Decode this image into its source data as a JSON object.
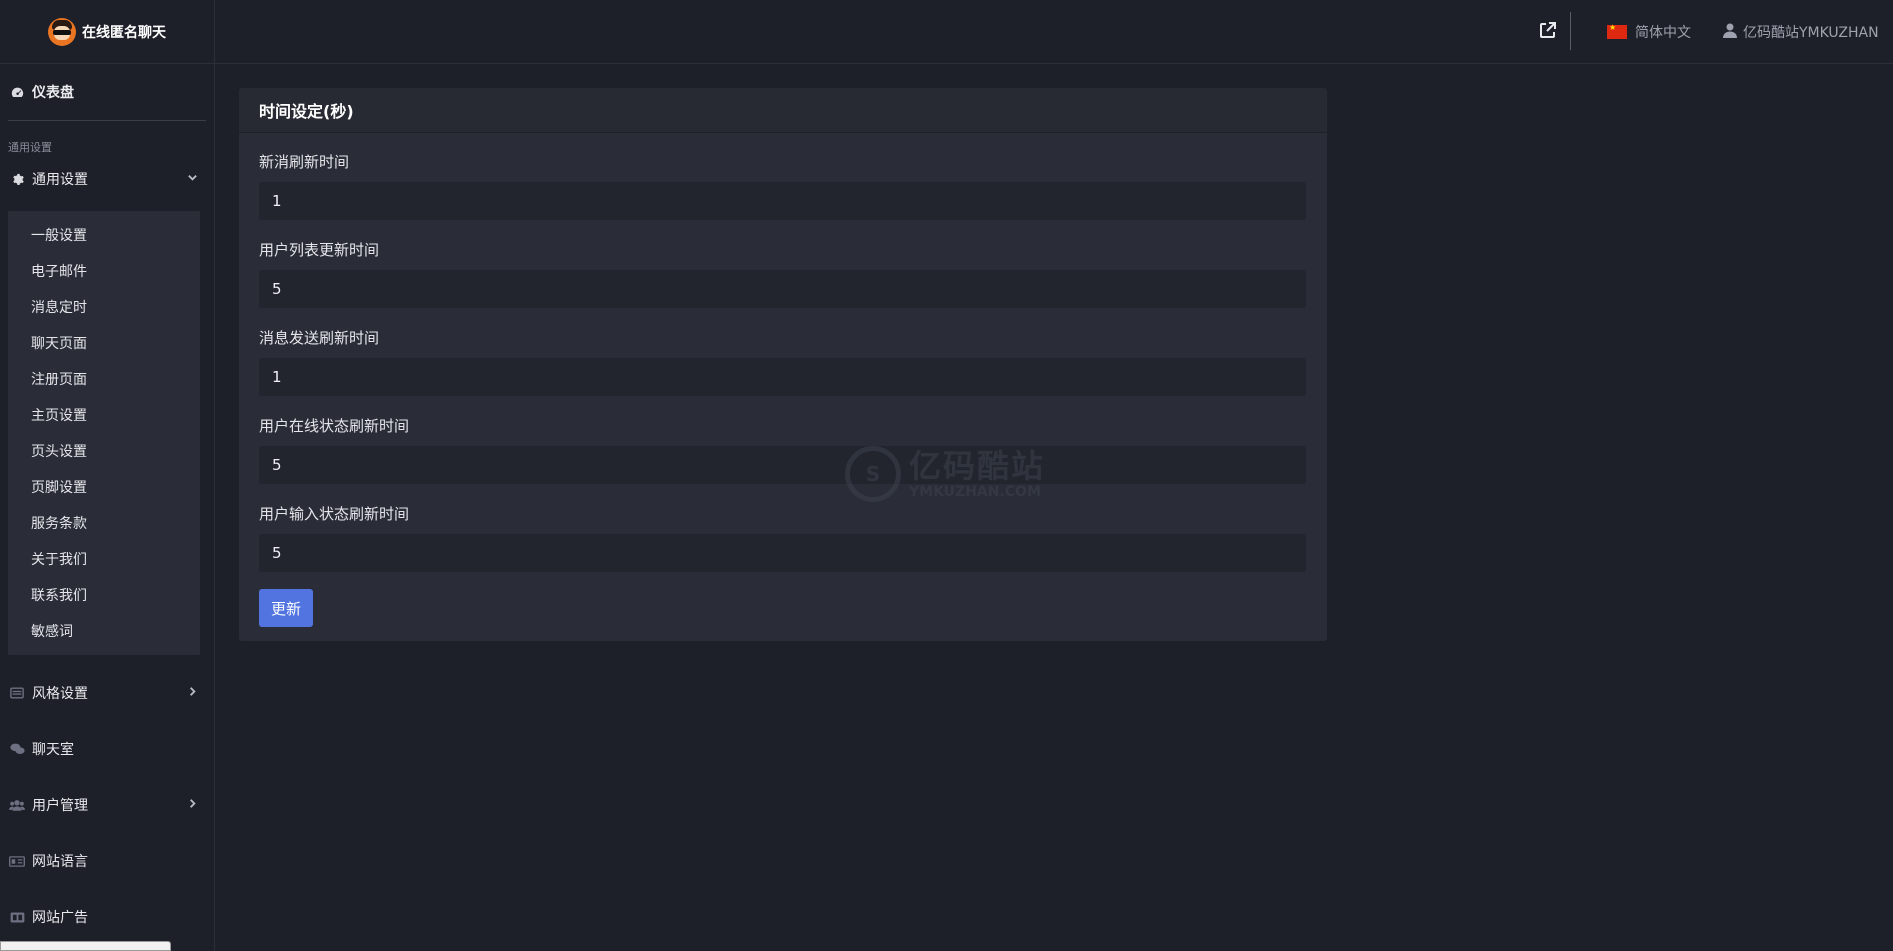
{
  "brand": {
    "title": "在线匿名聊天"
  },
  "header": {
    "language": "简体中文",
    "username": "亿码酷站YMKUZHAN"
  },
  "sidebar": {
    "dashboard": "仪表盘",
    "section_label": "通用设置",
    "general_settings": "通用设置",
    "submenu": [
      "一般设置",
      "电子邮件",
      "消息定时",
      "聊天页面",
      "注册页面",
      "主页设置",
      "页头设置",
      "页脚设置",
      "服务条款",
      "关于我们",
      "联系我们",
      "敏感词"
    ],
    "style_settings": "风格设置",
    "chat_rooms": "聊天室",
    "user_management": "用户管理",
    "site_language": "网站语言",
    "site_ads": "网站广告"
  },
  "card": {
    "title": "时间设定(秒)",
    "fields": [
      {
        "label": "新消刷新时间",
        "value": "1"
      },
      {
        "label": "用户列表更新时间",
        "value": "5"
      },
      {
        "label": "消息发送刷新时间",
        "value": "1"
      },
      {
        "label": "用户在线状态刷新时间",
        "value": "5"
      },
      {
        "label": "用户输入状态刷新时间",
        "value": "5"
      }
    ],
    "update_label": "更新"
  },
  "watermark": {
    "main": "亿码酷站",
    "sub": "YMKUZHAN.COM"
  },
  "colors": {
    "background": "#1e2029",
    "card": "#2a2d37",
    "input": "#22252e",
    "accent": "#5174e0"
  }
}
